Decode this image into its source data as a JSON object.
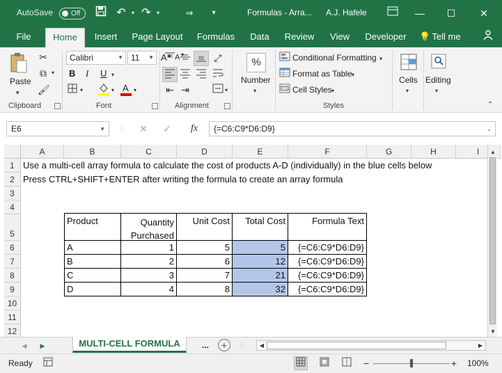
{
  "titlebar": {
    "autosave_label": "AutoSave",
    "autosave_state": "Off",
    "title": "Formulas - Arra...",
    "user": "A.J. Hafele"
  },
  "tabs": [
    "File",
    "Home",
    "Insert",
    "Page Layout",
    "Formulas",
    "Data",
    "Review",
    "View",
    "Developer",
    "Tell me"
  ],
  "active_tab": "Home",
  "ribbon": {
    "clipboard": {
      "paste_label": "Paste",
      "group_label": "Clipboard"
    },
    "font": {
      "font_name": "Calibri",
      "font_size": "11",
      "group_label": "Font",
      "bold": "B",
      "italic": "I",
      "underline": "U"
    },
    "alignment": {
      "group_label": "Alignment"
    },
    "number": {
      "label": "Number",
      "percent": "%"
    },
    "styles": {
      "conditional_formatting": "Conditional Formatting",
      "format_as_table": "Format as Table",
      "cell_styles": "Cell Styles",
      "group_label": "Styles"
    },
    "cells": {
      "label": "Cells"
    },
    "editing": {
      "label": "Editing"
    }
  },
  "formula_bar": {
    "name_box": "E6",
    "fx": "fx",
    "formula": "{=C6:C9*D6:D9}"
  },
  "columns": [
    "A",
    "B",
    "C",
    "D",
    "E",
    "F",
    "G",
    "H",
    "I"
  ],
  "rows": [
    "1",
    "2",
    "3",
    "4",
    "5",
    "6",
    "7",
    "8",
    "9",
    "10",
    "11",
    "12"
  ],
  "cells": {
    "A1": "Use a multi-cell array formula to calculate the cost of products A-D (individually) in the blue cells below",
    "A2": "Press CTRL+SHIFT+ENTER after writing the formula to create an array formula"
  },
  "table": {
    "headers": {
      "product": "Product",
      "qty_line1": "Quantity",
      "qty_line2": "Purchased",
      "unit_cost": "Unit Cost",
      "total_cost": "Total Cost",
      "formula_text": "Formula Text"
    },
    "rows": [
      {
        "product": "A",
        "qty": "1",
        "unit_cost": "5",
        "total": "5",
        "formula": "{=C6:C9*D6:D9}"
      },
      {
        "product": "B",
        "qty": "2",
        "unit_cost": "6",
        "total": "12",
        "formula": "{=C6:C9*D6:D9}"
      },
      {
        "product": "C",
        "qty": "3",
        "unit_cost": "7",
        "total": "21",
        "formula": "{=C6:C9*D6:D9}"
      },
      {
        "product": "D",
        "qty": "4",
        "unit_cost": "8",
        "total": "32",
        "formula": "{=C6:C9*D6:D9}"
      }
    ],
    "total_fill_color": "#b4c6e7"
  },
  "sheets": {
    "active": "MULTI-CELL FORMULA",
    "more": "..."
  },
  "status": {
    "ready": "Ready",
    "zoom": "100%"
  },
  "colors": {
    "brand": "#217346"
  }
}
